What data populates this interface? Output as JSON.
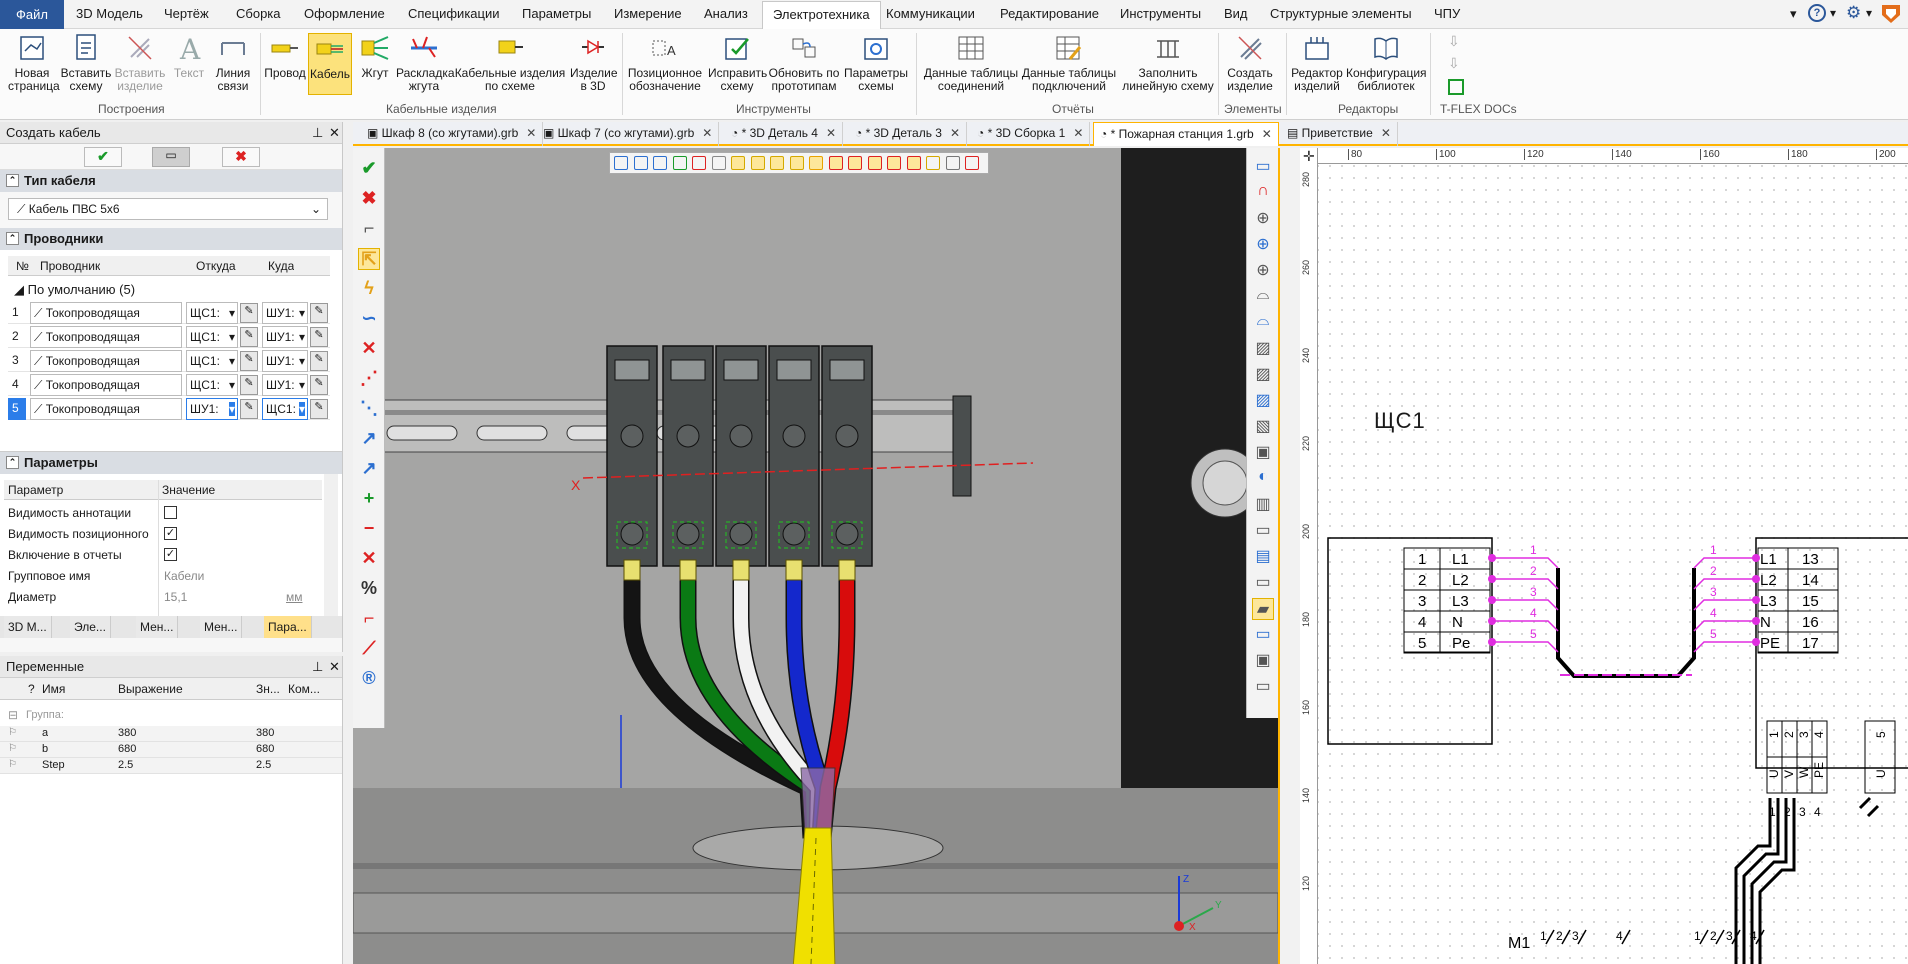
{
  "menu": {
    "file": "Файл",
    "items": [
      "3D Модель",
      "Чертёж",
      "Сборка",
      "Оформление",
      "Спецификации",
      "Параметры",
      "Измерение",
      "Анализ",
      "Электротехника",
      "Коммуникации",
      "Редактирование",
      "Инструменты",
      "Вид",
      "Структурные элементы",
      "ЧПУ"
    ],
    "active": "Электротехника"
  },
  "ribbon": {
    "build_buttons": [
      "Новая страница",
      "Вставить схему",
      "Вставить изделие",
      "Текст",
      "Линия связи"
    ],
    "build_label": "Построения",
    "cable_buttons": [
      "Провод",
      "Кабель",
      "Жгут",
      "Раскладка жгута",
      "Кабельные изделия по схеме",
      "Изделие в 3D"
    ],
    "cable_label": "Кабельные изделия",
    "tools_buttons": [
      "Позиционное обозначение",
      "Исправить схему",
      "Обновить по прототипам",
      "Параметры схемы"
    ],
    "tools_label": "Инструменты",
    "reports_buttons": [
      "Данные таблицы соединений",
      "Данные таблицы подключений",
      "Заполнить линейную схему"
    ],
    "reports_label": "Отчёты",
    "elements_buttons": [
      "Создать изделие"
    ],
    "elements_label": "Элементы",
    "editors_buttons": [
      "Редактор изделий",
      "Конфигурация библиотек"
    ],
    "editors_label": "Редакторы",
    "docs_label": "T-FLEX DOCs"
  },
  "doc_tabs": [
    "Шкаф 8 (со жгутами).grb",
    "Шкаф 7 (со жгутами).grb",
    "* 3D Деталь 4",
    "* 3D Деталь 3",
    "* 3D Сборка 1",
    "* Пожарная станция 1.grb",
    "Приветствие"
  ],
  "cable_panel": {
    "title": "Создать кабель",
    "section_type": "Тип кабеля",
    "cable_type": "Кабель ПВС 5х6",
    "section_wires": "Проводники",
    "col_no": "№",
    "col_wire": "Проводник",
    "col_from": "Откуда",
    "col_to": "Куда",
    "group": "По умолчанию (5)",
    "rows": [
      {
        "n": "1",
        "wire": "Токопроводящая",
        "from": "ЩС1:",
        "to": "ШУ1:"
      },
      {
        "n": "2",
        "wire": "Токопроводящая",
        "from": "ЩС1:",
        "to": "ШУ1:"
      },
      {
        "n": "3",
        "wire": "Токопроводящая",
        "from": "ЩС1:",
        "to": "ШУ1:"
      },
      {
        "n": "4",
        "wire": "Токопроводящая",
        "from": "ЩС1:",
        "to": "ШУ1:"
      },
      {
        "n": "5",
        "wire": "Токопроводящая",
        "from": "ШУ1:",
        "to": "ЩС1:"
      }
    ],
    "section_params": "Параметры",
    "col_param": "Параметр",
    "col_value": "Значение",
    "params": [
      {
        "name": "Видимость аннотации",
        "checked": false
      },
      {
        "name": "Видимость позиционного",
        "checked": true
      },
      {
        "name": "Включение в отчеты",
        "checked": true
      },
      {
        "name": "Групповое имя",
        "value": "Кабели"
      },
      {
        "name": "Диаметр",
        "value": "15,1",
        "unit": "мм"
      }
    ],
    "bottom_tabs": [
      "3D М...",
      "Эле...",
      "Мен...",
      "Мен...",
      "Пара..."
    ]
  },
  "variables_panel": {
    "title": "Переменные",
    "col_q": "?",
    "col_name": "Имя",
    "col_expr": "Выражение",
    "col_val": "Зн...",
    "col_comment": "Ком...",
    "group": "Группа:",
    "rows": [
      {
        "name": "a",
        "expr": "380",
        "val": "380"
      },
      {
        "name": "b",
        "expr": "680",
        "val": "680"
      },
      {
        "name": "Step",
        "expr": "2.5",
        "val": "2.5"
      }
    ]
  },
  "view3d": {
    "axis_x": "X",
    "axis_z": "Z",
    "axis_y": "Y",
    "wire_colors": [
      "#141414",
      "#0a7a14",
      "#f2f2f2",
      "#1428cc",
      "#d80c0c"
    ],
    "cable_color": "#f2e20c"
  },
  "schematic": {
    "ruler_top": [
      "80",
      "100",
      "120",
      "140",
      "160",
      "180",
      "200"
    ],
    "ruler_left": [
      "280",
      "260",
      "240",
      "220",
      "200",
      "180",
      "160",
      "140",
      "120"
    ],
    "block1_label": "ЩС1",
    "block1_rows": [
      [
        "1",
        "L1"
      ],
      [
        "2",
        "L2"
      ],
      [
        "3",
        "L3"
      ],
      [
        "4",
        "N"
      ],
      [
        "5",
        "Pe"
      ]
    ],
    "block2_rows": [
      [
        "L1",
        "13"
      ],
      [
        "L2",
        "14"
      ],
      [
        "L3",
        "15"
      ],
      [
        "N",
        "16"
      ],
      [
        "PE",
        "17"
      ]
    ],
    "wire_numbers": [
      "1",
      "2",
      "3",
      "4",
      "5"
    ],
    "terminal_top": [
      "1",
      "2",
      "3",
      "4",
      "5"
    ],
    "terminal_phase": [
      "U",
      "V",
      "W",
      "PE",
      "U"
    ],
    "terminal_bottom": [
      "1",
      "2",
      "3",
      "4"
    ],
    "motor_label": "M1",
    "motor_nums": [
      "1",
      "2",
      "3",
      "4",
      "1",
      "2",
      "3",
      "4"
    ]
  }
}
